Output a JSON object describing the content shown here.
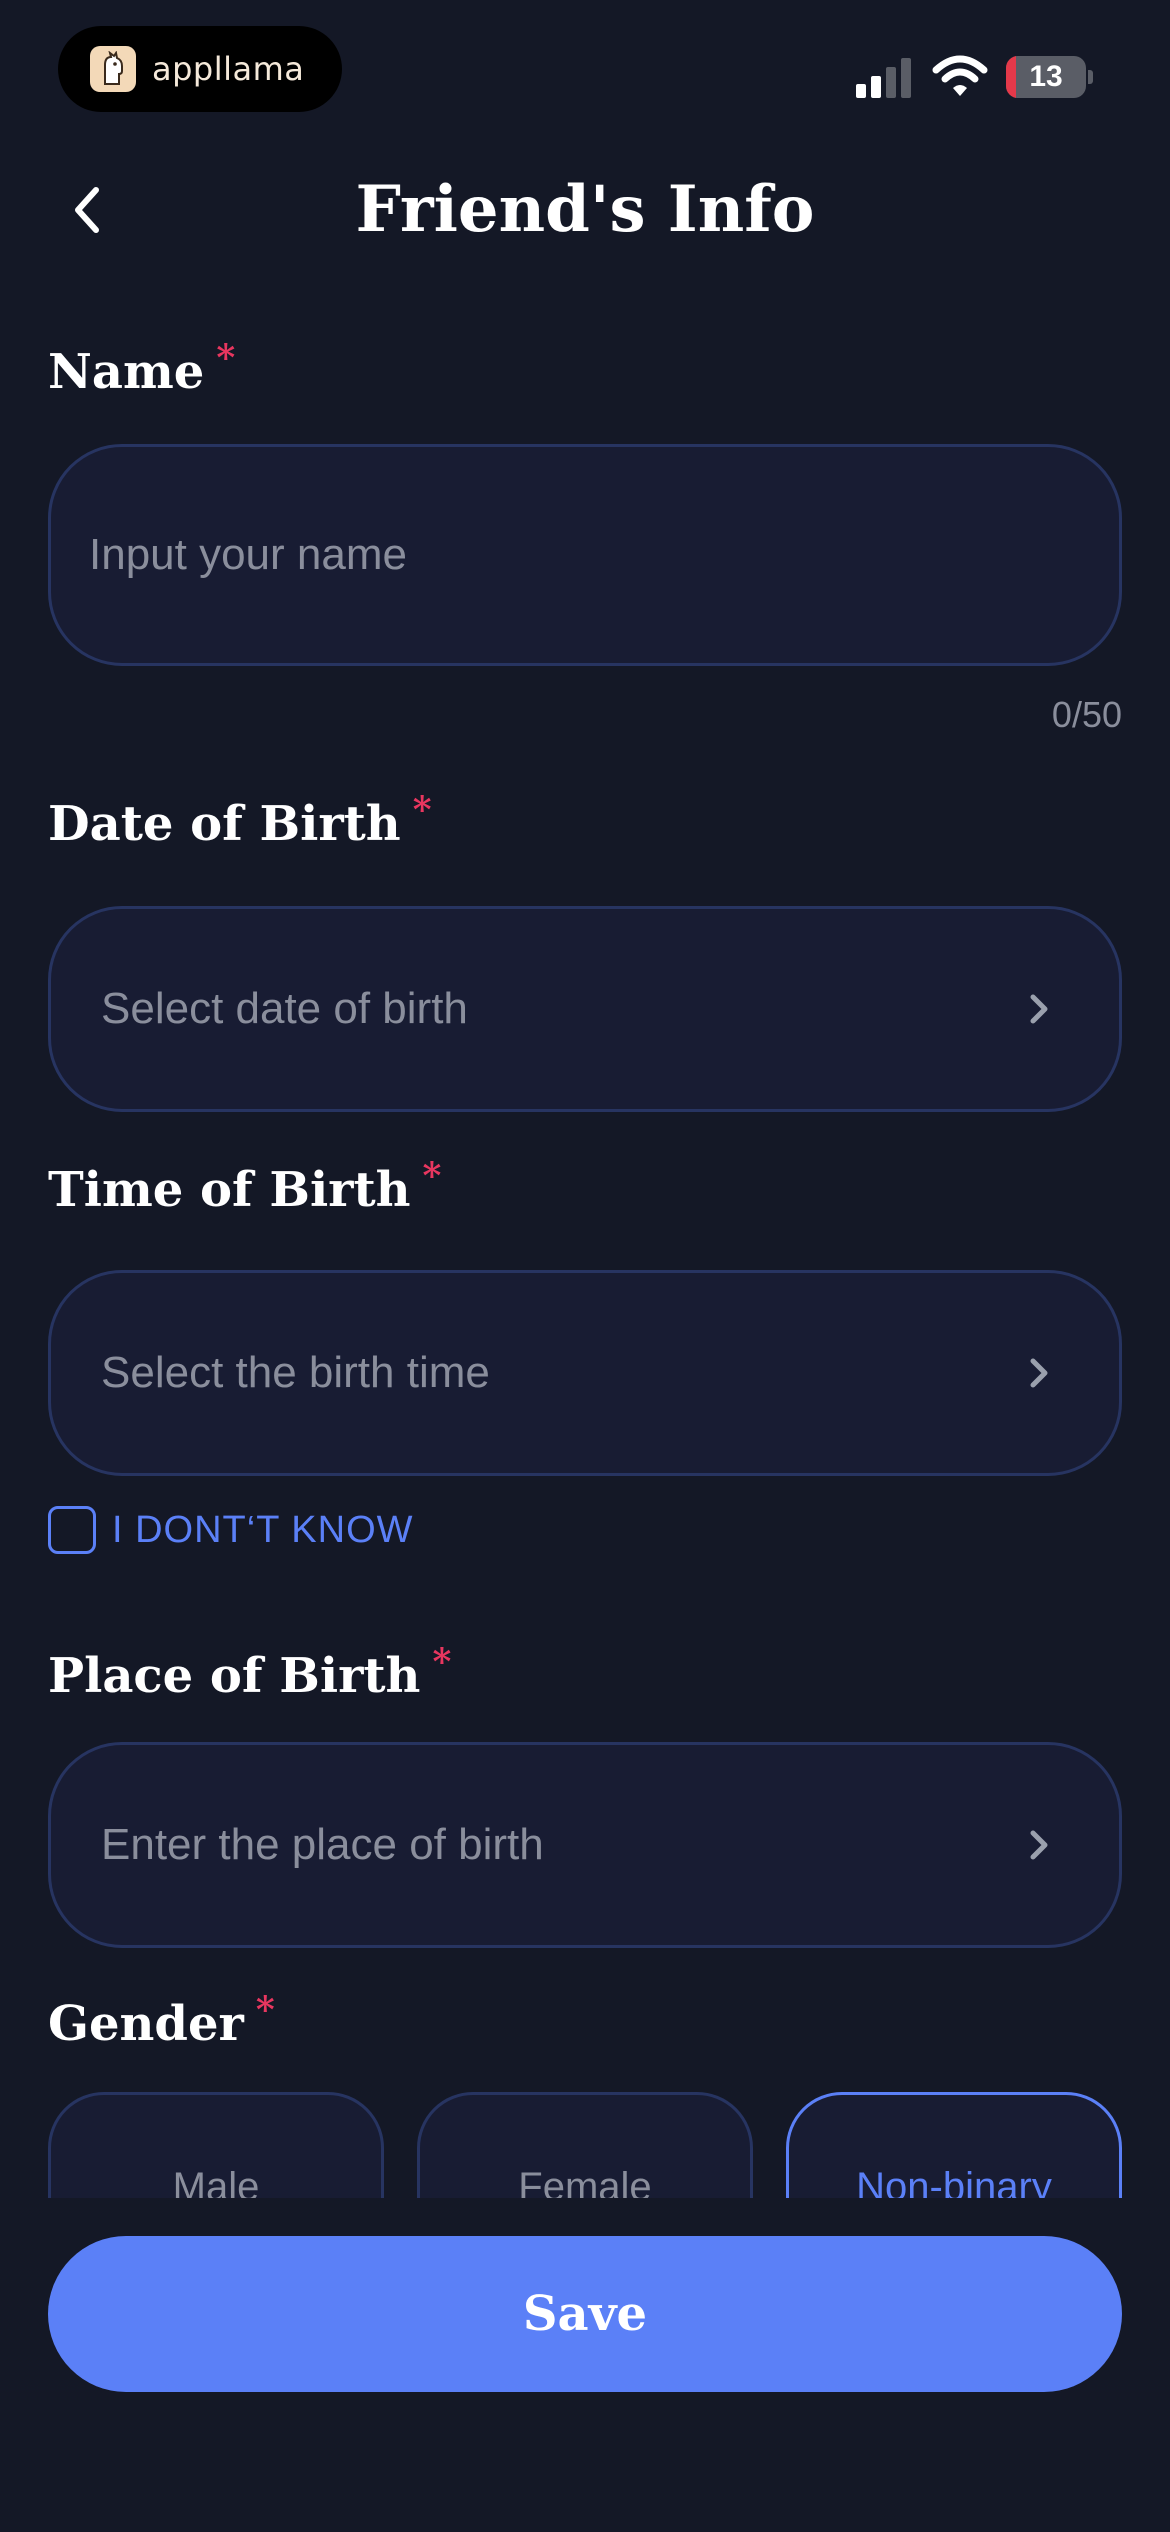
{
  "status_bar": {
    "app_name": "appllama",
    "battery_level": "13",
    "battery_fraction": 0.13
  },
  "header": {
    "title": "Friend's Info"
  },
  "form": {
    "name": {
      "label": "Name",
      "required_mark": "*",
      "value": "",
      "placeholder": "Input your name",
      "counter": "0/50"
    },
    "dob": {
      "label": "Date of Birth",
      "required_mark": "*",
      "placeholder": "Select date of birth"
    },
    "tob": {
      "label": "Time of Birth",
      "required_mark": "*",
      "placeholder": "Select the birth time",
      "unknown_label": "I DONT‘T KNOW",
      "unknown_checked": false
    },
    "pob": {
      "label": "Place of Birth",
      "required_mark": "*",
      "placeholder": "Enter the place of birth"
    },
    "gender": {
      "label": "Gender",
      "required_mark": "*",
      "options": [
        "Male",
        "Female",
        "Non-binary"
      ],
      "selected": "Non-binary"
    }
  },
  "actions": {
    "save_label": "Save"
  },
  "colors": {
    "background": "#141826",
    "field_bg": "#181c33",
    "field_border": "#273461",
    "accent": "#5b80f7",
    "required": "#e8365f",
    "placeholder": "#8a8e9c"
  },
  "icons": {
    "back": "chevron-left-icon",
    "select": "chevron-right-icon",
    "signal": "cellular-signal-icon",
    "wifi": "wifi-icon",
    "battery": "battery-icon",
    "app_logo": "llama-logo-icon"
  }
}
